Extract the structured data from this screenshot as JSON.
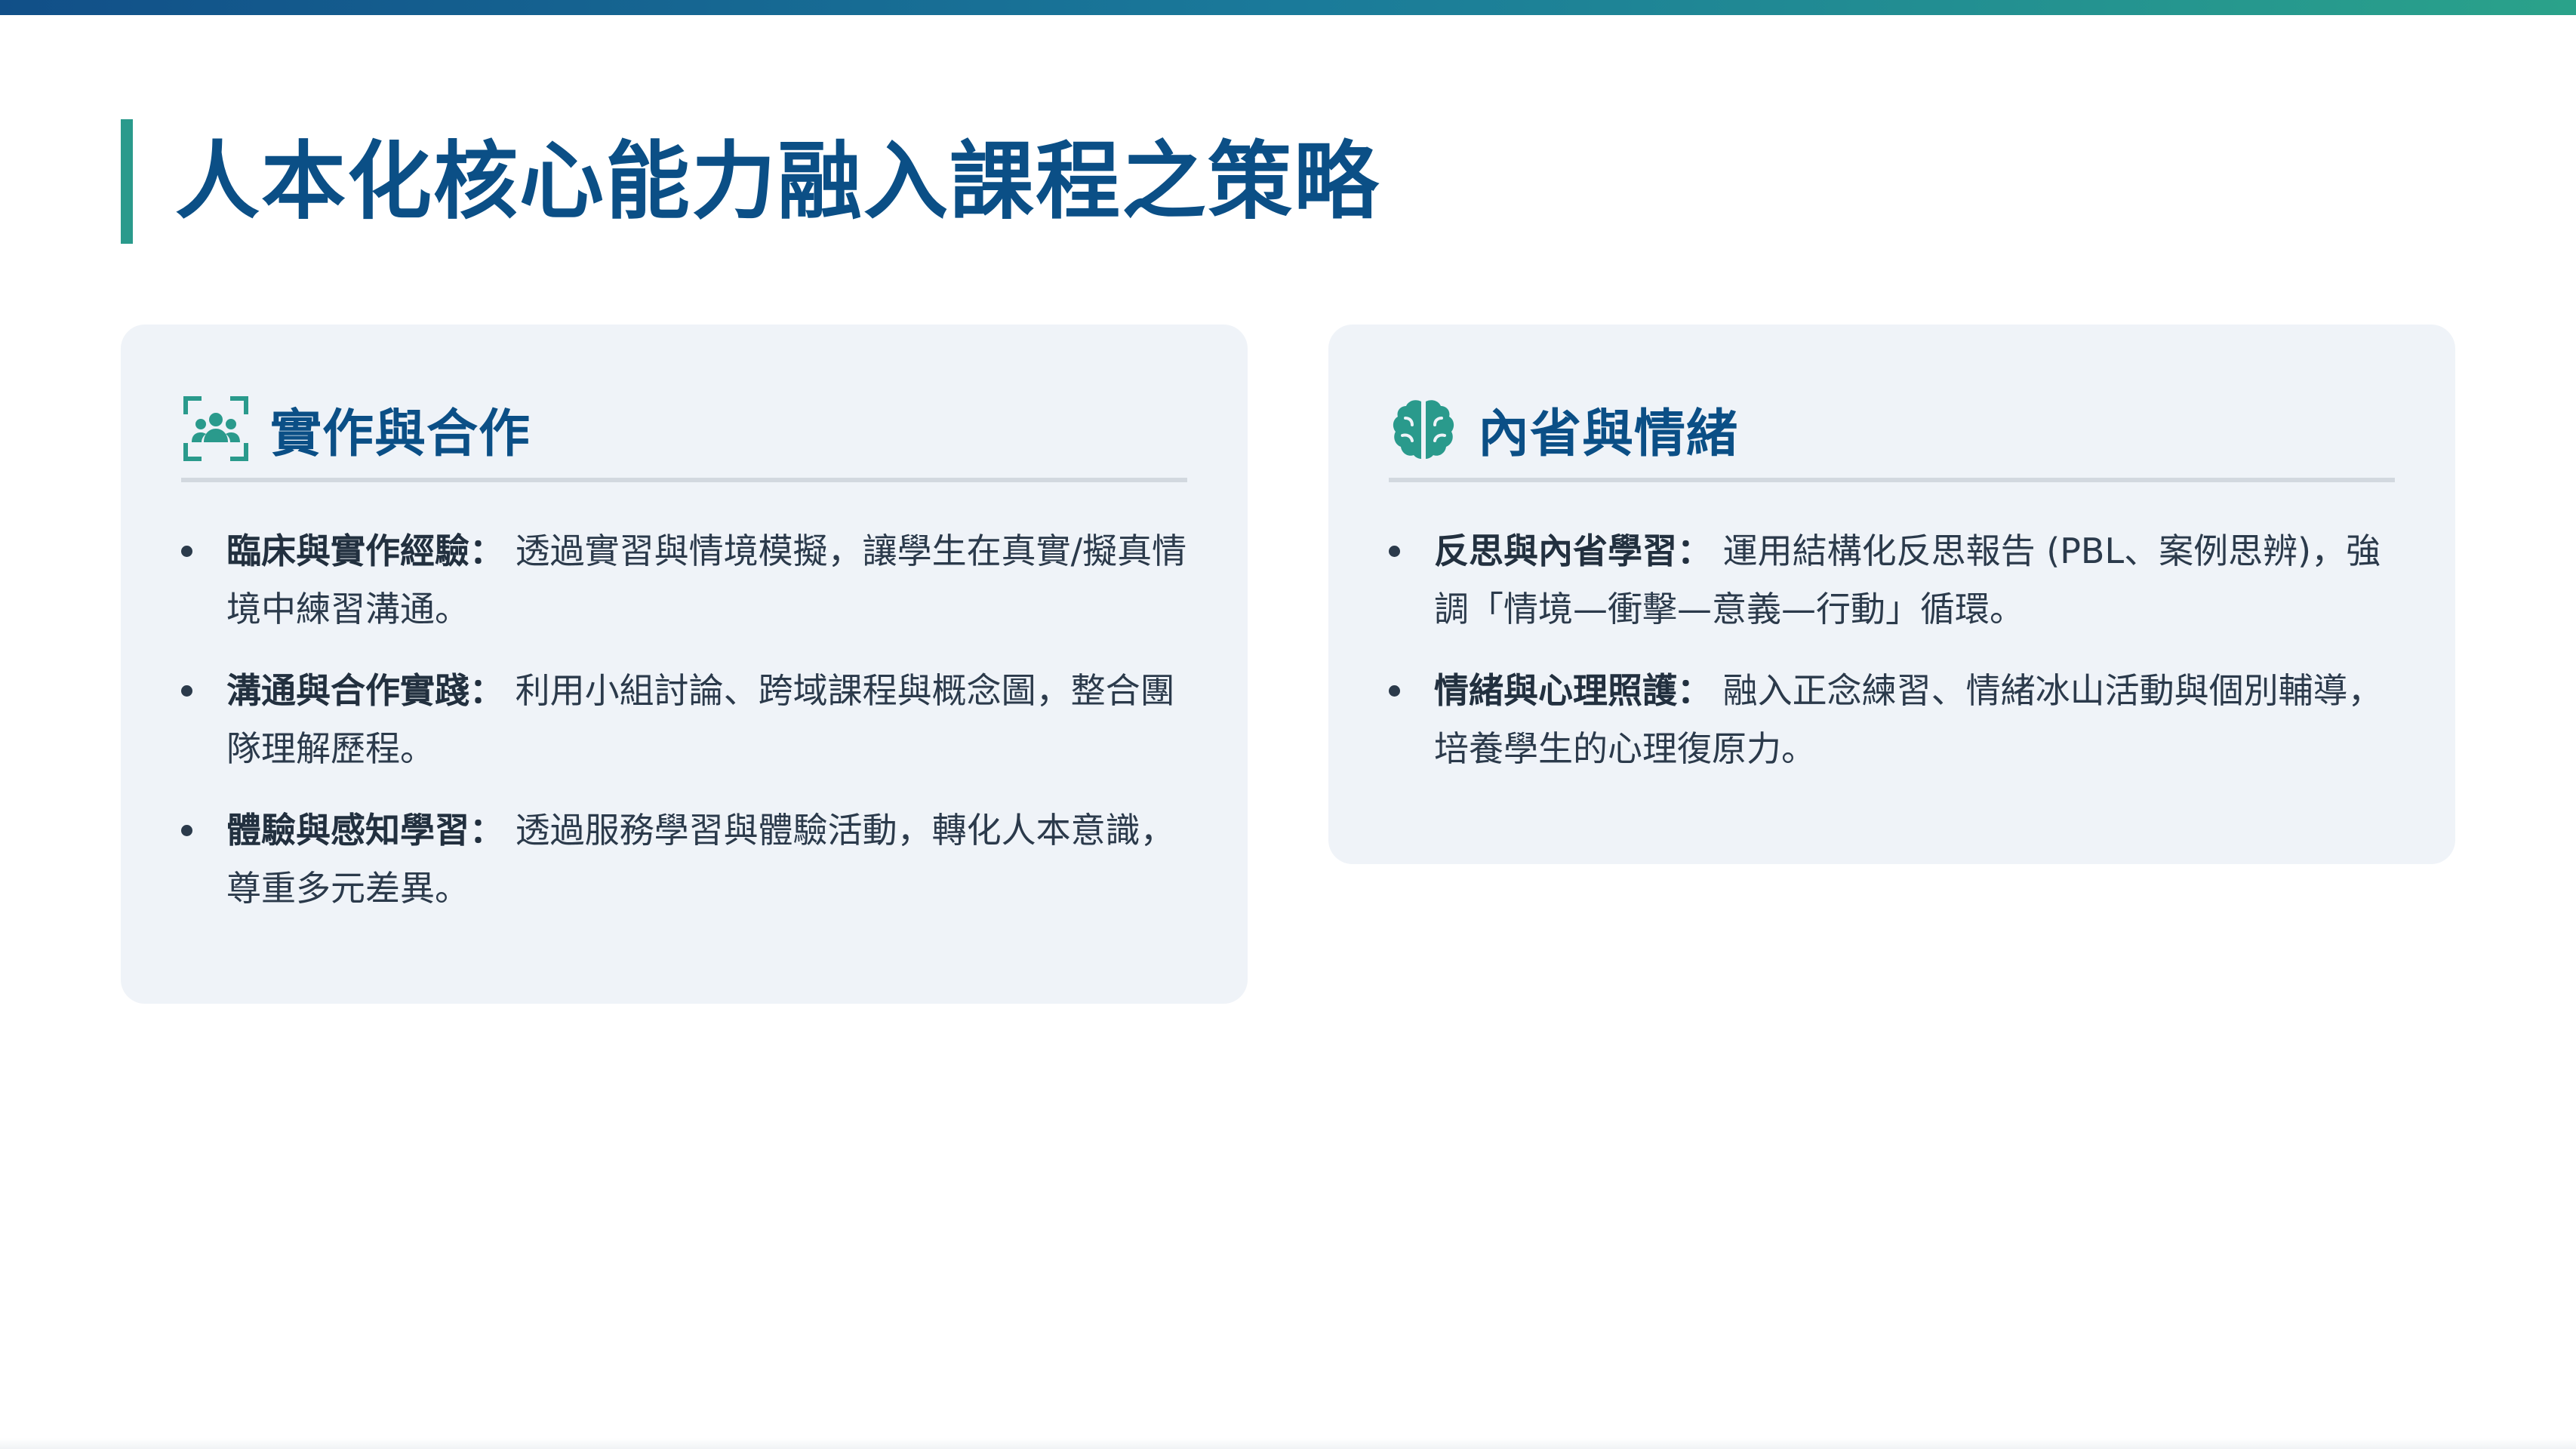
{
  "page": {
    "title": "人本化核心能力融入課程之策略"
  },
  "cards": [
    {
      "title": "實作與合作",
      "icon": "team-scan-icon",
      "items": [
        {
          "label": "臨床與實作經驗：",
          "text": "透過實習與情境模擬，讓學生在真實/擬真情境中練習溝通。"
        },
        {
          "label": "溝通與合作實踐：",
          "text": "利用小組討論、跨域課程與概念圖，整合團隊理解歷程。"
        },
        {
          "label": "體驗與感知學習：",
          "text": "透過服務學習與體驗活動，轉化人本意識，尊重多元差異。"
        }
      ]
    },
    {
      "title": "內省與情緒",
      "icon": "brain-icon",
      "items": [
        {
          "label": "反思與內省學習：",
          "text": "運用結構化反思報告 (PBL、案例思辨)，強調「情境—衝擊—意義—行動」循環。"
        },
        {
          "label": "情緒與心理照護：",
          "text": "融入正念練習、情緒冰山活動與個別輔導，培養學生的心理復原力。"
        }
      ]
    }
  ],
  "colors": {
    "title": "#0b4f86",
    "accent": "#2a9a8c",
    "card_background": "#eff3f8",
    "body_text": "#2b3a4b"
  }
}
